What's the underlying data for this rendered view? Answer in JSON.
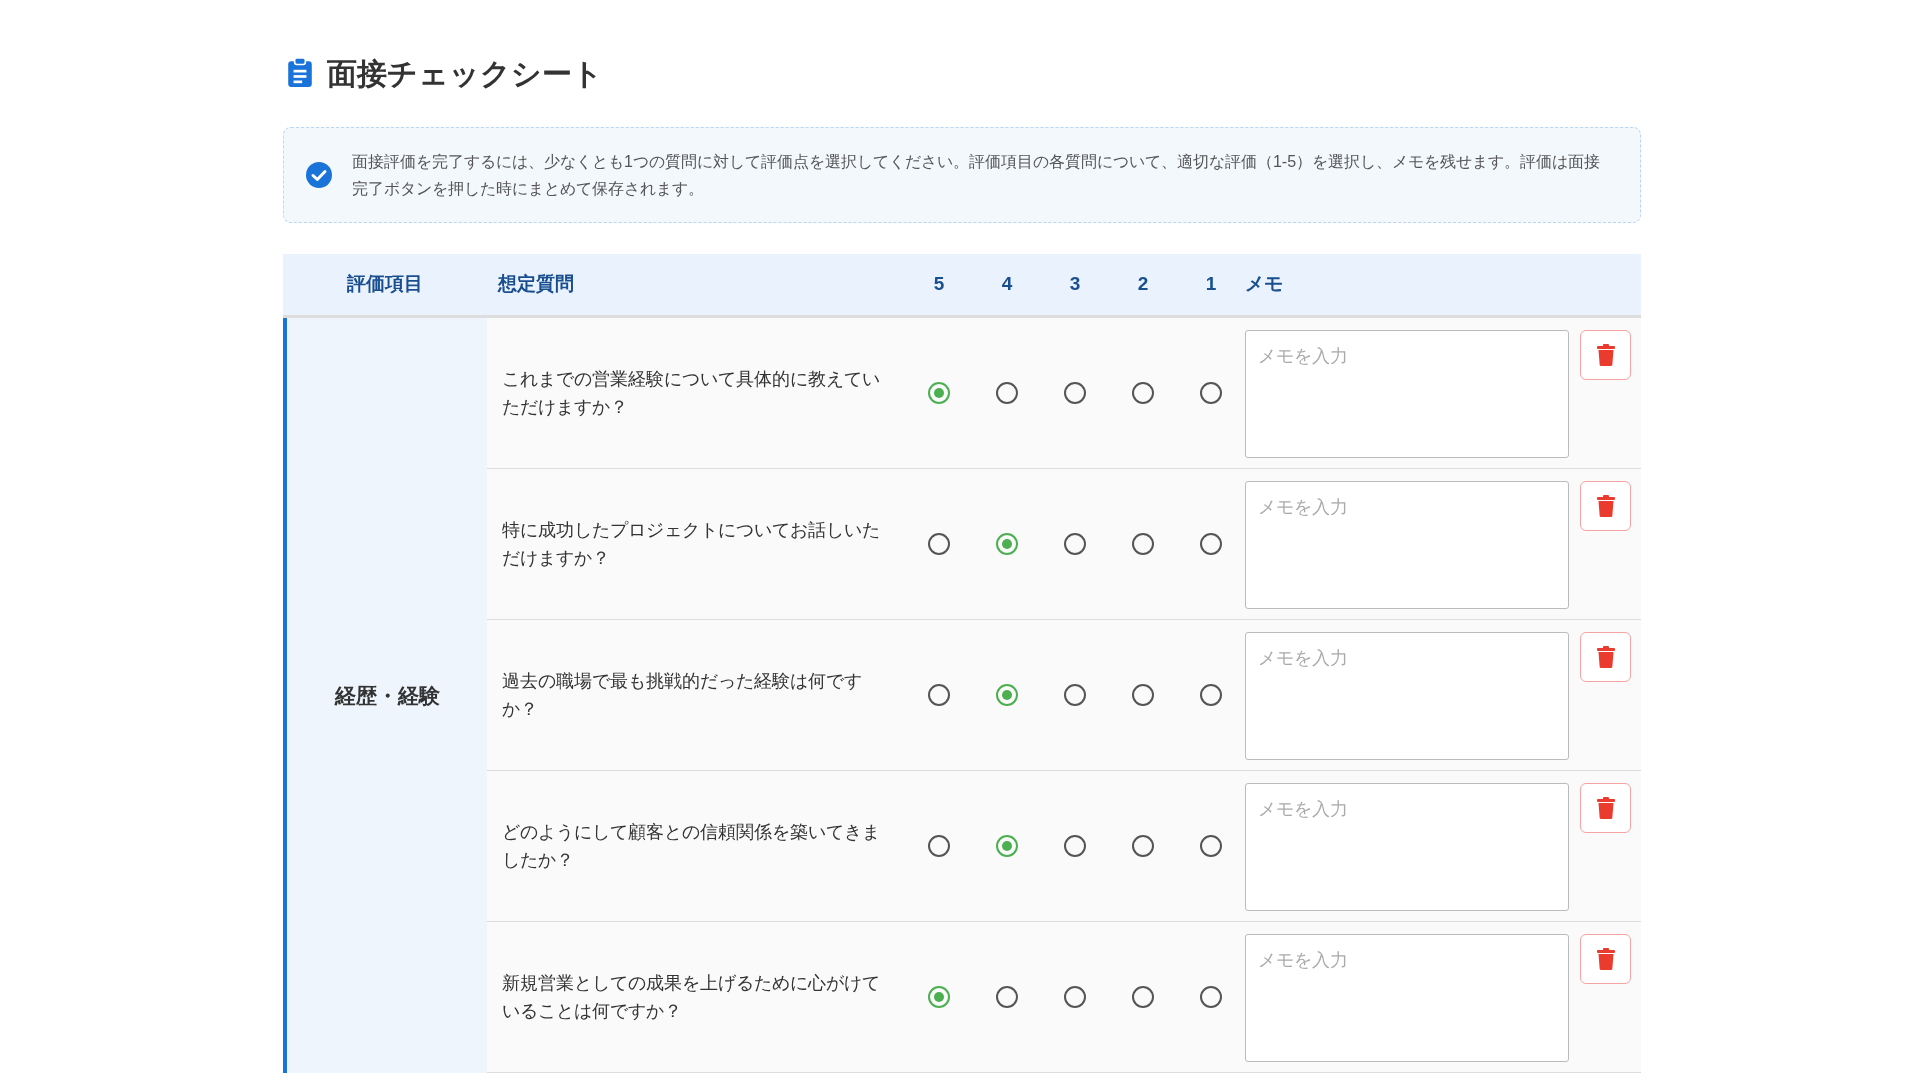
{
  "title": "面接チェックシート",
  "notice": "面接評価を完了するには、少なくとも1つの質問に対して評価点を選択してください。評価項目の各質問について、適切な評価（1-5）を選択し、メモを残せます。評価は面接完了ボタンを押した時にまとめて保存されます。",
  "table": {
    "columns": [
      "評価項目",
      "想定質問",
      "5",
      "4",
      "3",
      "2",
      "1",
      "メモ"
    ],
    "categories": [
      {
        "name": "経歴・経験",
        "questions": [
          {
            "text": "これまでの営業経験について具体的に教えていただけますか？",
            "ratings": [
              {
                "selected": true
              },
              {
                "selected": false
              },
              {
                "selected": false
              },
              {
                "selected": false
              },
              {
                "selected": false
              }
            ],
            "memo_placeholder": "メモを入力"
          },
          {
            "text": "特に成功したプロジェクトについてお話しいただけますか？",
            "ratings": [
              {
                "selected": false
              },
              {
                "selected": true
              },
              {
                "selected": false
              },
              {
                "selected": false
              },
              {
                "selected": false
              }
            ],
            "memo_placeholder": "メモを入力"
          },
          {
            "text": "過去の職場で最も挑戦的だった経験は何ですか？",
            "ratings": [
              {
                "selected": false
              },
              {
                "selected": true
              },
              {
                "selected": false
              },
              {
                "selected": false
              },
              {
                "selected": false
              }
            ],
            "memo_placeholder": "メモを入力"
          },
          {
            "text": "どのようにして顧客との信頼関係を築いてきましたか？",
            "ratings": [
              {
                "selected": false
              },
              {
                "selected": true
              },
              {
                "selected": false
              },
              {
                "selected": false
              },
              {
                "selected": false
              }
            ],
            "memo_placeholder": "メモを入力"
          },
          {
            "text": "新規営業としての成果を上げるために心がけていることは何ですか？",
            "ratings": [
              {
                "selected": true
              },
              {
                "selected": false
              },
              {
                "selected": false
              },
              {
                "selected": false
              },
              {
                "selected": false
              }
            ],
            "memo_placeholder": "メモを入力"
          }
        ]
      }
    ]
  }
}
